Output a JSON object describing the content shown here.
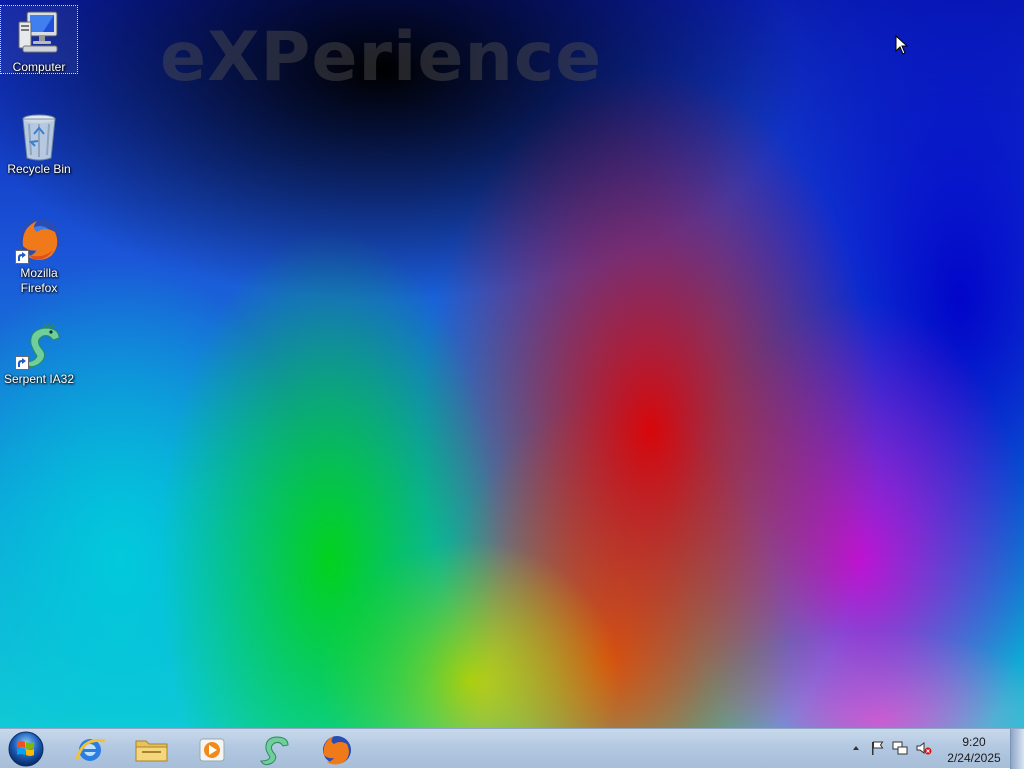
{
  "desktop": {
    "watermark": "eXPerience",
    "icons": [
      {
        "label": "Computer",
        "icon": "computer-icon",
        "selected": true
      },
      {
        "label": "Recycle Bin",
        "icon": "recycle-bin-icon"
      },
      {
        "label": "Mozilla Firefox",
        "icon": "firefox-icon",
        "shortcut": true
      },
      {
        "label": "Serpent IA32",
        "icon": "serpent-icon",
        "shortcut": true
      }
    ]
  },
  "taskbar": {
    "start": {
      "icon": "windows-orb-icon"
    },
    "pinned": [
      {
        "icon": "internet-explorer-icon"
      },
      {
        "icon": "file-explorer-icon"
      },
      {
        "icon": "media-player-icon"
      },
      {
        "icon": "serpent-icon"
      },
      {
        "icon": "firefox-icon"
      }
    ],
    "tray": {
      "icons": [
        "show-hidden-icons-chevron",
        "action-center-flag-icon",
        "network-icon",
        "volume-muted-icon"
      ],
      "time": "9:20",
      "date": "2/24/2025"
    }
  }
}
